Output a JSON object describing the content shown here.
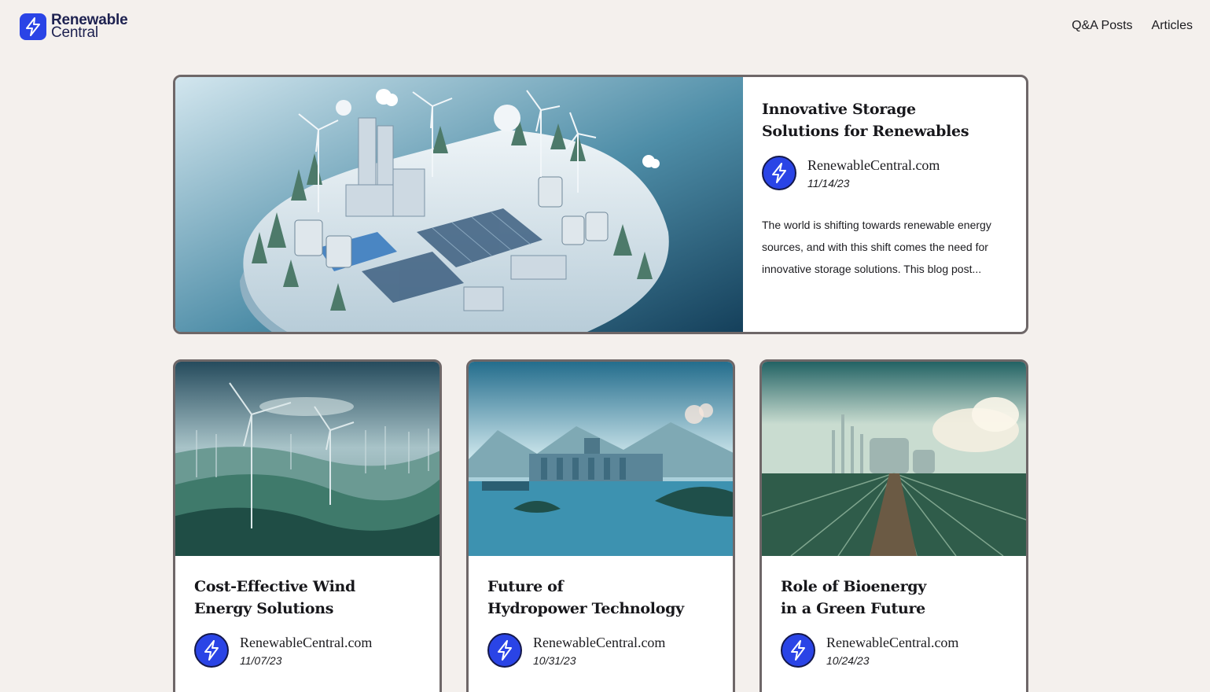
{
  "brand": {
    "name_line1": "Renewable",
    "name_line2": "Central",
    "color": "#2a44e6"
  },
  "nav": {
    "items": [
      {
        "label": "Q&A Posts"
      },
      {
        "label": "Articles"
      }
    ]
  },
  "featured": {
    "title_line1": "Innovative Storage",
    "title_line2": "Solutions for Renewables",
    "author": "RenewableCentral.com",
    "date": "11/14/23",
    "excerpt": "The world is shifting towards renewable energy sources, and with this shift comes the need for innovative storage solutions. This blog post...",
    "image_icon": "energy-storage-city-illustration"
  },
  "cards": [
    {
      "title_line1": "Cost-Effective Wind",
      "title_line2": "Energy Solutions",
      "author": "RenewableCentral.com",
      "date": "11/07/23",
      "image_icon": "wind-farm-illustration"
    },
    {
      "title_line1": "Future of",
      "title_line2": "Hydropower Technology",
      "author": "RenewableCentral.com",
      "date": "10/31/23",
      "image_icon": "hydropower-dam-illustration"
    },
    {
      "title_line1": "Role of Bioenergy",
      "title_line2": "in a Green Future",
      "author": "RenewableCentral.com",
      "date": "10/24/23",
      "image_icon": "bioenergy-plant-field-illustration"
    }
  ]
}
